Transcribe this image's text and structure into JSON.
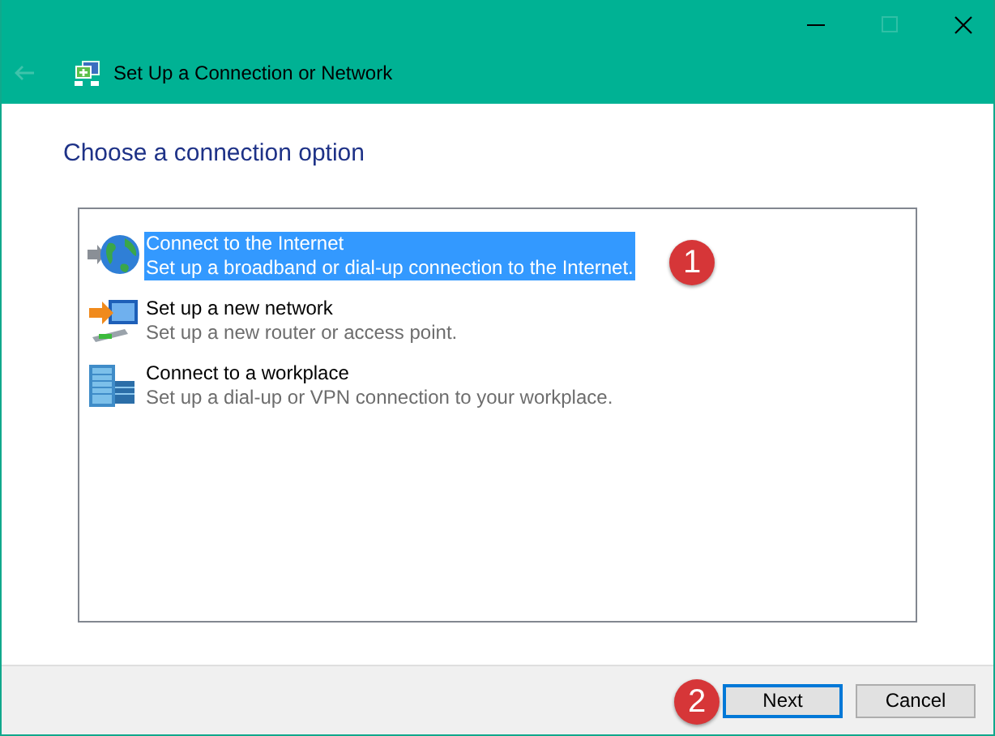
{
  "window": {
    "title": "Set Up a Connection or Network"
  },
  "heading": "Choose a connection option",
  "options": [
    {
      "kind": "internet",
      "title": "Connect to the Internet",
      "description": "Set up a broadband or dial-up connection to the Internet.",
      "selected": true
    },
    {
      "kind": "network",
      "title": "Set up a new network",
      "description": "Set up a new router or access point.",
      "selected": false
    },
    {
      "kind": "workplace",
      "title": "Connect to a workplace",
      "description": "Set up a dial-up or VPN connection to your workplace.",
      "selected": false
    }
  ],
  "callouts": [
    "1",
    "2"
  ],
  "buttons": [
    {
      "label": "Next",
      "default": true
    },
    {
      "label": "Cancel",
      "default": false
    }
  ]
}
